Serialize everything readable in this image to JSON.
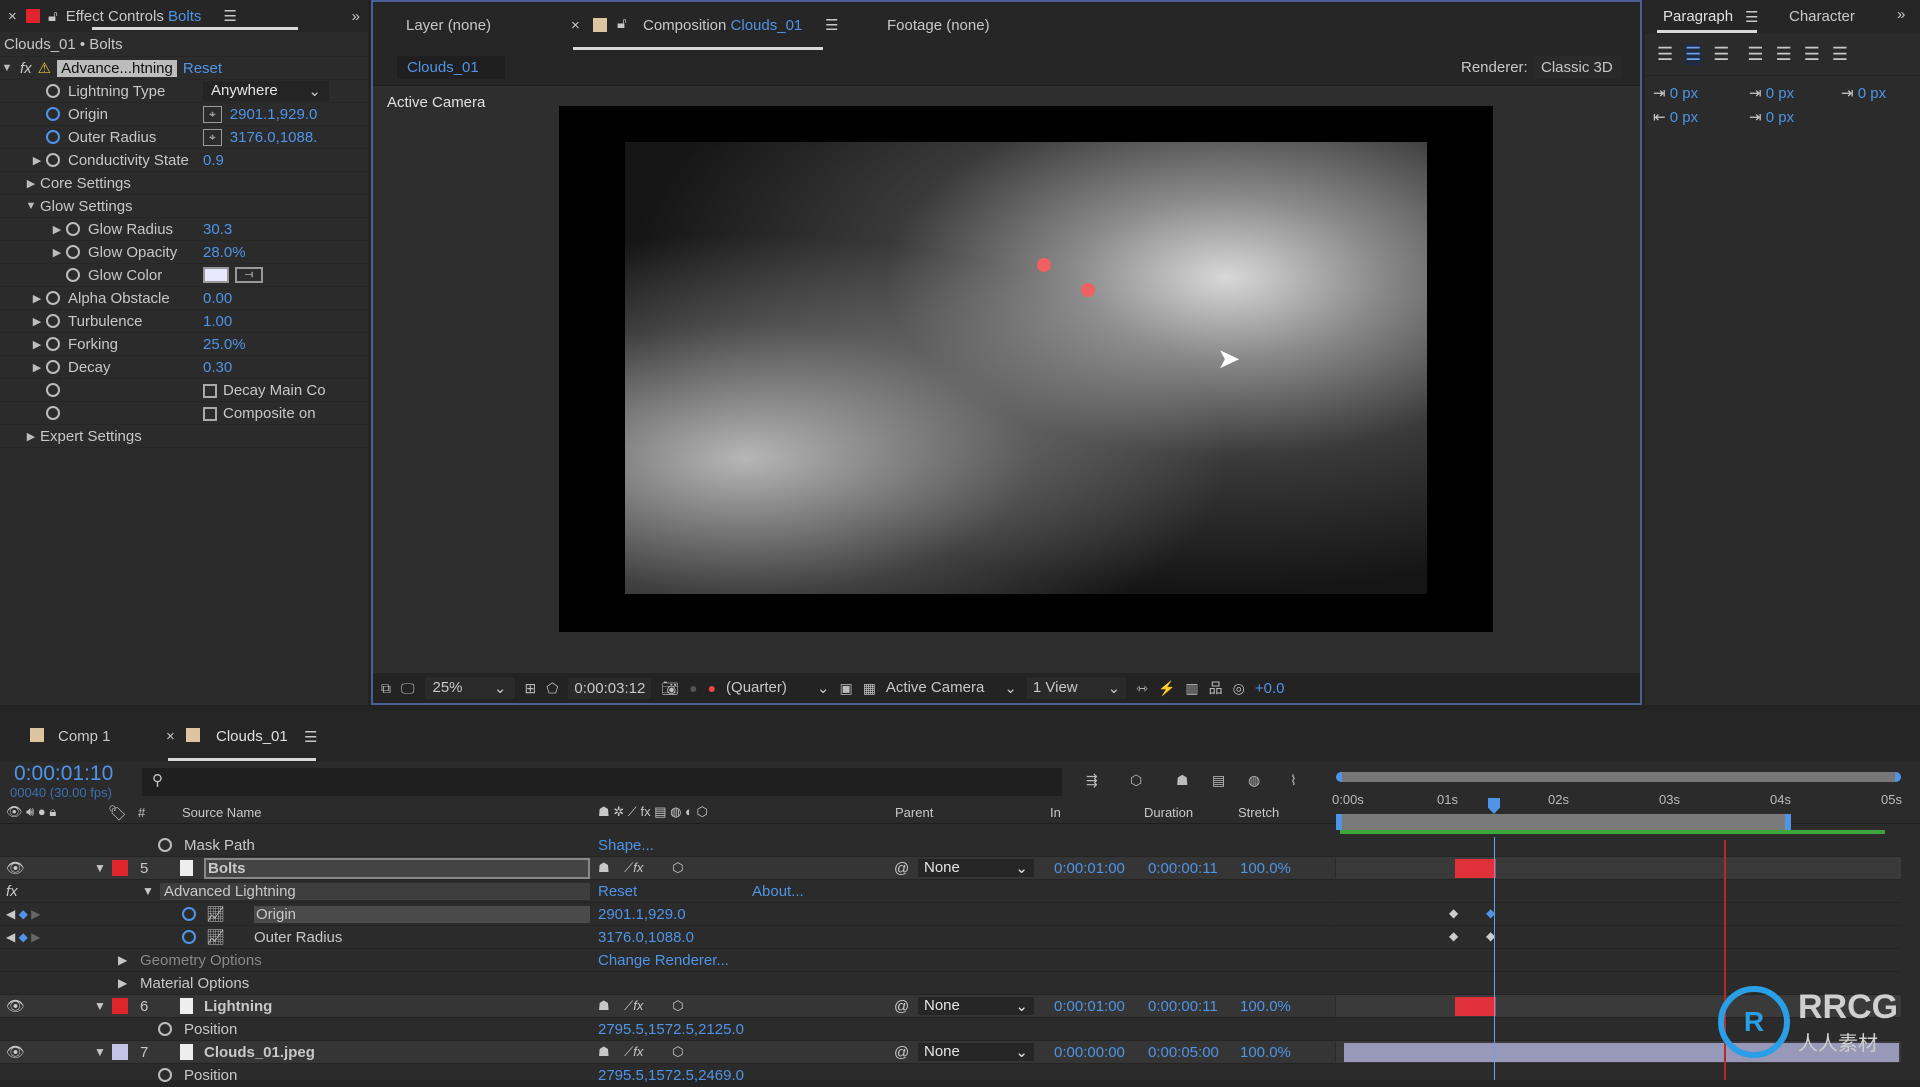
{
  "effect_controls": {
    "tab_label": "Effect Controls",
    "tab_layer": "Bolts",
    "breadcrumb": "Clouds_01 • Bolts",
    "effect_name": "Advance...htning",
    "reset_label": "Reset",
    "properties": [
      {
        "label": "Lightning Type",
        "value": "Anywhere",
        "type": "dropdown"
      },
      {
        "label": "Origin",
        "value": "2901.1,929.0",
        "type": "point"
      },
      {
        "label": "Outer Radius",
        "value": "3176.0,1088.",
        "type": "point"
      },
      {
        "label": "Conductivity State",
        "value": "0.9"
      },
      {
        "label": "Core Settings",
        "type": "group"
      },
      {
        "label": "Glow Settings",
        "type": "group-open"
      },
      {
        "label": "Glow Radius",
        "value": "30.3",
        "indent": true
      },
      {
        "label": "Glow Opacity",
        "value": "28.0%",
        "indent": true
      },
      {
        "label": "Glow Color",
        "type": "color",
        "indent": true
      },
      {
        "label": "Alpha Obstacle",
        "value": "0.00"
      },
      {
        "label": "Turbulence",
        "value": "1.00"
      },
      {
        "label": "Forking",
        "value": "25.0%"
      },
      {
        "label": "Decay",
        "value": "0.30"
      },
      {
        "label": "Decay Main Co",
        "type": "checkbox"
      },
      {
        "label": "Composite on",
        "type": "checkbox"
      },
      {
        "label": "Expert Settings",
        "type": "group"
      }
    ]
  },
  "composition": {
    "layer_tab": "Layer (none)",
    "comp_tab_prefix": "Composition",
    "comp_tab_name": "Clouds_01",
    "footage_tab": "Footage (none)",
    "comp_chip": "Clouds_01",
    "renderer_label": "Renderer:",
    "renderer_value": "Classic 3D",
    "view_label": "Active Camera",
    "toolbar": {
      "zoom": "25%",
      "timecode": "0:00:03:12",
      "resolution": "(Quarter)",
      "camera": "Active Camera",
      "views": "1 View",
      "exposure": "+0.0"
    }
  },
  "paragraph": {
    "tab_paragraph": "Paragraph",
    "tab_character": "Character",
    "indent_values": [
      "0 px",
      "0 px",
      "0 px",
      "0 px",
      "0 px"
    ]
  },
  "timeline": {
    "tabs": [
      "Comp 1",
      "Clouds_01"
    ],
    "current_time": "0:00:01:10",
    "frame_info": "00040 (30.00 fps)",
    "columns": {
      "source_name": "Source Name",
      "parent": "Parent",
      "in": "In",
      "duration": "Duration",
      "stretch": "Stretch"
    },
    "ruler": [
      "0:00s",
      "01s",
      "02s",
      "03s",
      "04s",
      "05s"
    ],
    "rows": [
      {
        "kind": "prop",
        "label": "Mask Path",
        "value": "Shape..."
      },
      {
        "kind": "layer",
        "num": "5",
        "name": "Bolts",
        "color": "#e0242c",
        "parent": "None",
        "in": "0:00:01:00",
        "duration": "0:00:00:11",
        "stretch": "100.0%"
      },
      {
        "kind": "effect",
        "label": "Advanced Lightning",
        "reset": "Reset",
        "about": "About..."
      },
      {
        "kind": "prop",
        "label": "Origin",
        "value": "2901.1,929.0"
      },
      {
        "kind": "prop",
        "label": "Outer Radius",
        "value": "3176.0,1088.0"
      },
      {
        "kind": "group",
        "label": "Geometry Options",
        "value": "Change Renderer..."
      },
      {
        "kind": "group",
        "label": "Material Options",
        "value": ""
      },
      {
        "kind": "layer",
        "num": "6",
        "name": "Lightning",
        "color": "#e0242c",
        "parent": "None",
        "in": "0:00:01:00",
        "duration": "0:00:00:11",
        "stretch": "100.0%"
      },
      {
        "kind": "prop",
        "label": "Position",
        "value": "2795.5,1572.5,2125.0"
      },
      {
        "kind": "layer",
        "num": "7",
        "name": "Clouds_01.jpeg",
        "color": "#c4c4e8",
        "parent": "None",
        "in": "0:00:00:00",
        "duration": "0:00:05:00",
        "stretch": "100.0%"
      },
      {
        "kind": "prop",
        "label": "Position",
        "value": "2795.5,1572.5,2469.0"
      }
    ]
  },
  "watermark": {
    "brand": "RRCG",
    "sub": "人人素材"
  }
}
